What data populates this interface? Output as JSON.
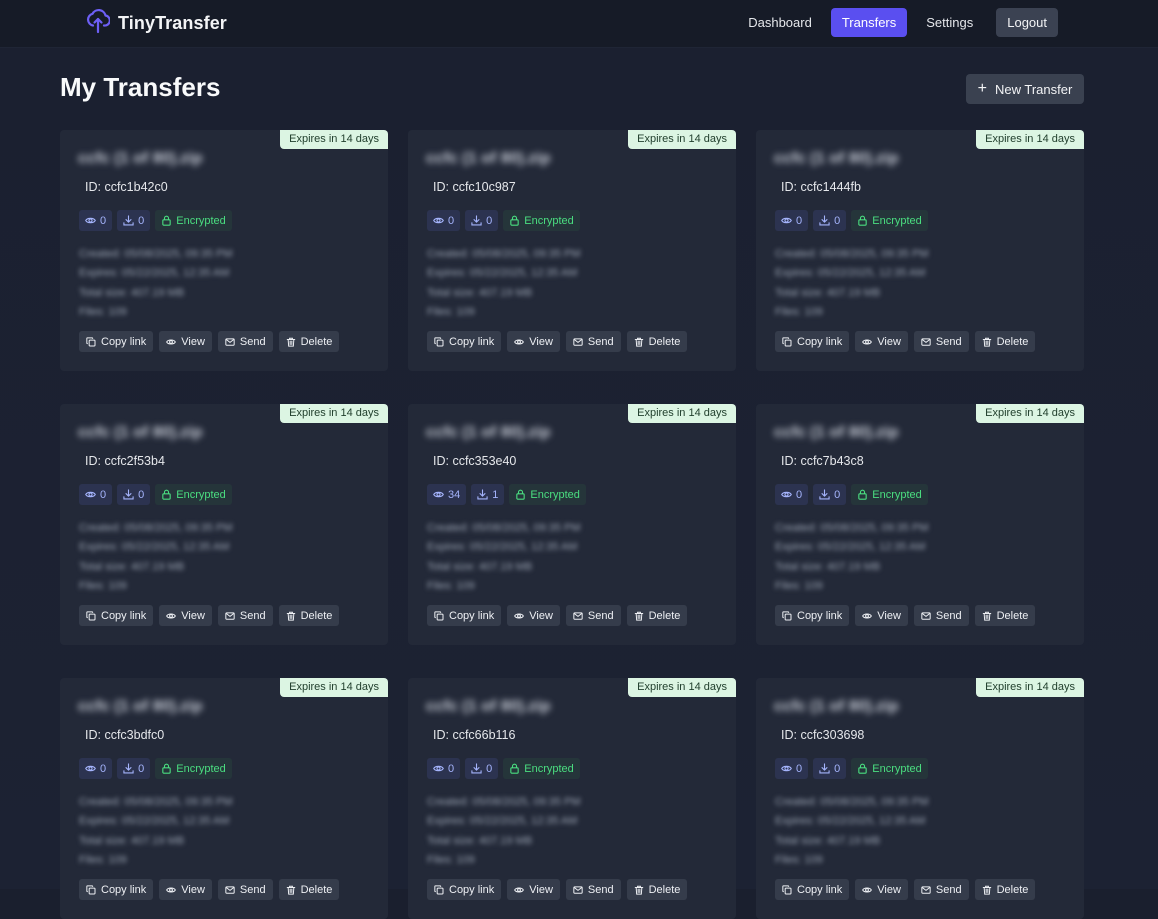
{
  "app": {
    "name": "TinyTransfer"
  },
  "nav": {
    "items": [
      {
        "label": "Dashboard",
        "active": false
      },
      {
        "label": "Transfers",
        "active": true
      },
      {
        "label": "Settings",
        "active": false
      }
    ],
    "logout_label": "Logout"
  },
  "page": {
    "title": "My Transfers",
    "new_button_label": "New Transfer"
  },
  "labels": {
    "encrypted": "Encrypted",
    "copy_link": "Copy link",
    "view": "View",
    "send": "Send",
    "delete": "Delete"
  },
  "colors": {
    "accent": "#5a4ff0",
    "expires_bg": "#dcf5e3",
    "encrypted_green": "#4ade80"
  },
  "transfers": [
    {
      "expires": "Expires in 14 days",
      "name": "ccfc (1 of 80).zip",
      "id": "ID: ccfc1b42c0",
      "views": "0",
      "downloads": "0",
      "created": "Created: 05/08/2025, 09:35 PM",
      "expires_at": "Expires: 05/22/2025, 12:35 AM",
      "size": "Total size: 407.19 MB",
      "files": "Files: 109"
    },
    {
      "expires": "Expires in 14 days",
      "name": "ccfc (1 of 80).zip",
      "id": "ID: ccfc10c987",
      "views": "0",
      "downloads": "0",
      "created": "Created: 05/08/2025, 09:35 PM",
      "expires_at": "Expires: 05/22/2025, 12:35 AM",
      "size": "Total size: 407.19 MB",
      "files": "Files: 109"
    },
    {
      "expires": "Expires in 14 days",
      "name": "ccfc (1 of 80).zip",
      "id": "ID: ccfc1444fb",
      "views": "0",
      "downloads": "0",
      "created": "Created: 05/08/2025, 09:35 PM",
      "expires_at": "Expires: 05/22/2025, 12:35 AM",
      "size": "Total size: 407.19 MB",
      "files": "Files: 109"
    },
    {
      "expires": "Expires in 14 days",
      "name": "ccfc (1 of 80).zip",
      "id": "ID: ccfc2f53b4",
      "views": "0",
      "downloads": "0",
      "created": "Created: 05/08/2025, 09:35 PM",
      "expires_at": "Expires: 05/22/2025, 12:35 AM",
      "size": "Total size: 407.19 MB",
      "files": "Files: 109"
    },
    {
      "expires": "Expires in 14 days",
      "name": "ccfc (1 of 80).zip",
      "id": "ID: ccfc353e40",
      "views": "34",
      "downloads": "1",
      "created": "Created: 05/08/2025, 09:35 PM",
      "expires_at": "Expires: 05/22/2025, 12:35 AM",
      "size": "Total size: 407.19 MB",
      "files": "Files: 109"
    },
    {
      "expires": "Expires in 14 days",
      "name": "ccfc (1 of 80).zip",
      "id": "ID: ccfc7b43c8",
      "views": "0",
      "downloads": "0",
      "created": "Created: 05/08/2025, 09:35 PM",
      "expires_at": "Expires: 05/22/2025, 12:35 AM",
      "size": "Total size: 407.19 MB",
      "files": "Files: 109"
    },
    {
      "expires": "Expires in 14 days",
      "name": "ccfc (1 of 80).zip",
      "id": "ID: ccfc3bdfc0",
      "views": "0",
      "downloads": "0",
      "created": "Created: 05/08/2025, 09:35 PM",
      "expires_at": "Expires: 05/22/2025, 12:35 AM",
      "size": "Total size: 407.19 MB",
      "files": "Files: 109"
    },
    {
      "expires": "Expires in 14 days",
      "name": "ccfc (1 of 80).zip",
      "id": "ID: ccfc66b116",
      "views": "0",
      "downloads": "0",
      "created": "Created: 05/08/2025, 09:35 PM",
      "expires_at": "Expires: 05/22/2025, 12:35 AM",
      "size": "Total size: 407.19 MB",
      "files": "Files: 109"
    },
    {
      "expires": "Expires in 14 days",
      "name": "ccfc (1 of 80).zip",
      "id": "ID: ccfc303698",
      "views": "0",
      "downloads": "0",
      "created": "Created: 05/08/2025, 09:35 PM",
      "expires_at": "Expires: 05/22/2025, 12:35 AM",
      "size": "Total size: 407.19 MB",
      "files": "Files: 109"
    }
  ]
}
